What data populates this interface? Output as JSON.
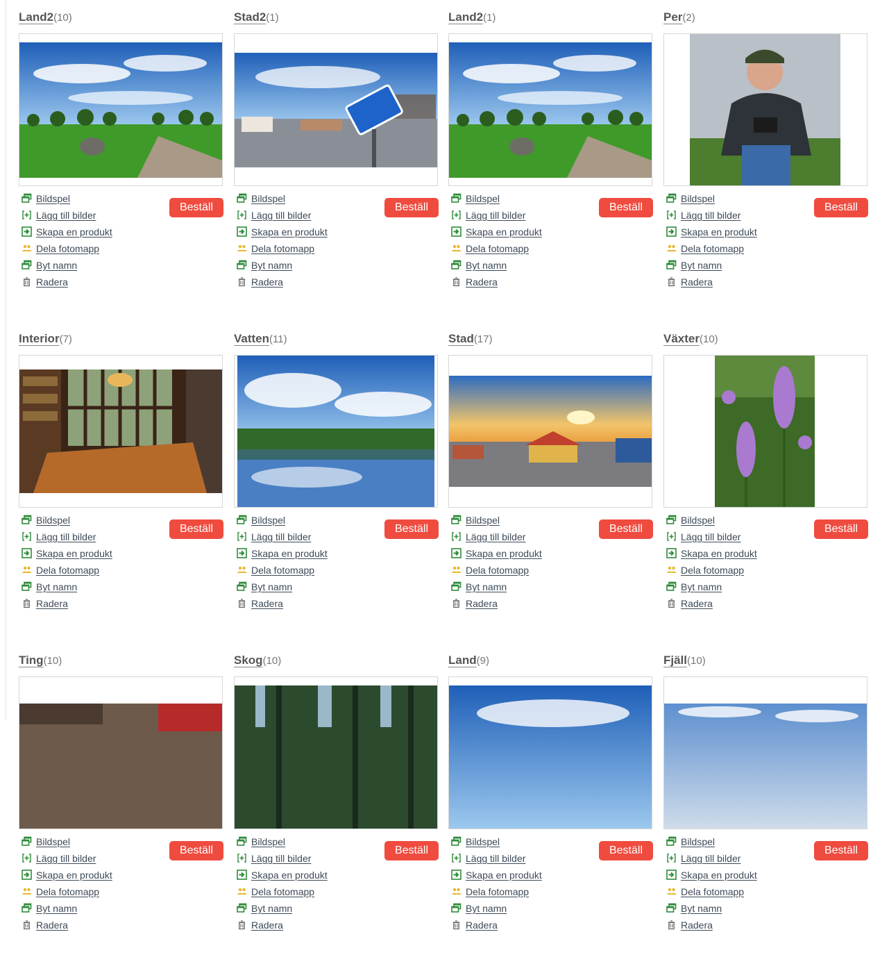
{
  "actions": {
    "slideshow": "Bildspel",
    "add_images": "Lägg till bilder",
    "create_product": "Skapa en produkt",
    "share_folder": "Dela fotomapp",
    "rename": "Byt namn",
    "delete": "Radera"
  },
  "order_label": "Beställ",
  "count_suffix_open": "(",
  "count_suffix_close": ")",
  "icons": {
    "slideshow": "window-icon",
    "add_images": "plus-bracket-icon",
    "create_product": "arrow-in-box-icon",
    "share_folder": "users-icon",
    "rename": "window-icon",
    "delete": "trash-icon"
  },
  "colors": {
    "order_button": "#ef4b3f",
    "icon_green": "#2e8b3a",
    "icon_yellow": "#e8b830",
    "link": "#3d4a57"
  },
  "folders": [
    {
      "name": "Land2",
      "count": "10",
      "photo": "meadow"
    },
    {
      "name": "Stad2",
      "count": "1",
      "photo": "sign"
    },
    {
      "name": "Land2",
      "count": "1",
      "photo": "meadow"
    },
    {
      "name": "Per",
      "count": "2",
      "photo": "portrait"
    },
    {
      "name": "Interior",
      "count": "7",
      "photo": "library"
    },
    {
      "name": "Vatten",
      "count": "11",
      "photo": "lake"
    },
    {
      "name": "Stad",
      "count": "17",
      "photo": "town"
    },
    {
      "name": "Växter",
      "count": "10",
      "photo": "flowers"
    },
    {
      "name": "Ting",
      "count": "10",
      "photo": "things"
    },
    {
      "name": "Skog",
      "count": "10",
      "photo": "forest"
    },
    {
      "name": "Land",
      "count": "9",
      "photo": "sky"
    },
    {
      "name": "Fjäll",
      "count": "10",
      "photo": "mountain"
    }
  ]
}
